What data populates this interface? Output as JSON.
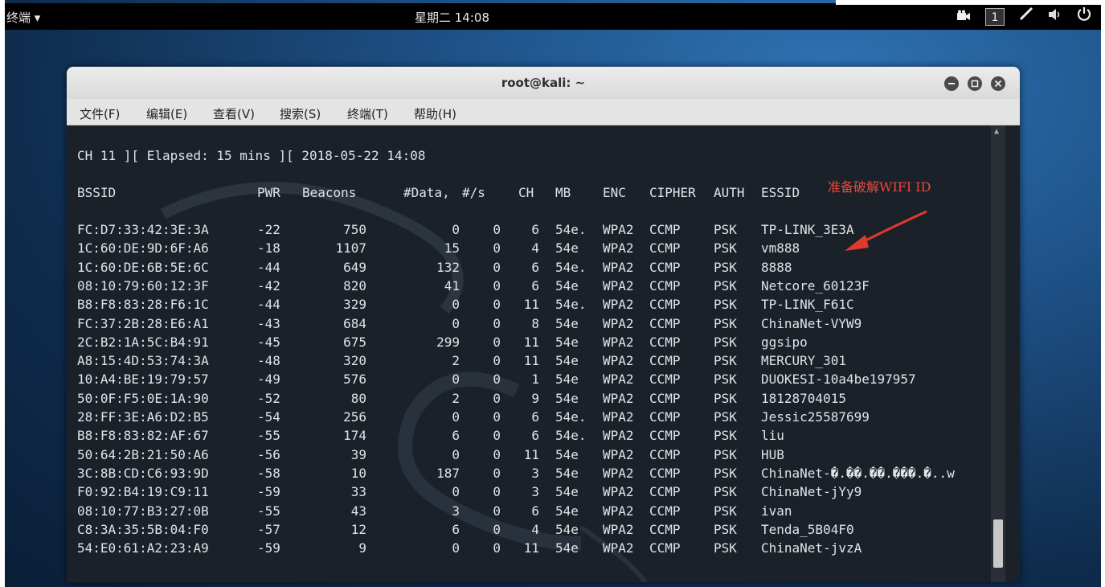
{
  "topbar": {
    "app_menu": "终端 ▾",
    "clock": "星期二 14:08",
    "workspace": "1",
    "icons": [
      "video-icon",
      "pen-icon",
      "volume-icon",
      "power-icon"
    ]
  },
  "window": {
    "title": "root@kali: ~",
    "menu": [
      "文件(F)",
      "编辑(E)",
      "查看(V)",
      "搜索(S)",
      "终端(T)",
      "帮助(H)"
    ]
  },
  "terminal": {
    "status_line": "CH 11 ][ Elapsed: 15 mins ][ 2018-05-22 14:08",
    "headers": [
      "BSSID",
      "PWR",
      "Beacons",
      "#Data,",
      "#/s",
      "CH",
      "MB",
      "ENC",
      "CIPHER",
      "AUTH",
      "ESSID"
    ],
    "annotation": "准备破解WIFI ID",
    "rows": [
      [
        "FC:D7:33:42:3E:3A",
        "-22",
        "750",
        "0",
        "0",
        "6",
        "54e.",
        "WPA2",
        "CCMP",
        "PSK",
        "TP-LINK_3E3A"
      ],
      [
        "1C:60:DE:9D:6F:A6",
        "-18",
        "1107",
        "15",
        "0",
        "4",
        "54e",
        "WPA2",
        "CCMP",
        "PSK",
        "vm888"
      ],
      [
        "1C:60:DE:6B:5E:6C",
        "-44",
        "649",
        "132",
        "0",
        "6",
        "54e.",
        "WPA2",
        "CCMP",
        "PSK",
        "8888"
      ],
      [
        "08:10:79:60:12:3F",
        "-42",
        "820",
        "41",
        "0",
        "6",
        "54e",
        "WPA2",
        "CCMP",
        "PSK",
        "Netcore_60123F"
      ],
      [
        "B8:F8:83:28:F6:1C",
        "-44",
        "329",
        "0",
        "0",
        "11",
        "54e.",
        "WPA2",
        "CCMP",
        "PSK",
        "TP-LINK_F61C"
      ],
      [
        "FC:37:2B:28:E6:A1",
        "-43",
        "684",
        "0",
        "0",
        "8",
        "54e",
        "WPA2",
        "CCMP",
        "PSK",
        "ChinaNet-VYW9"
      ],
      [
        "2C:B2:1A:5C:B4:91",
        "-45",
        "675",
        "299",
        "0",
        "11",
        "54e",
        "WPA2",
        "CCMP",
        "PSK",
        "ggsipo"
      ],
      [
        "A8:15:4D:53:74:3A",
        "-48",
        "320",
        "2",
        "0",
        "11",
        "54e",
        "WPA2",
        "CCMP",
        "PSK",
        "MERCURY_301"
      ],
      [
        "10:A4:BE:19:79:57",
        "-49",
        "576",
        "0",
        "0",
        "1",
        "54e",
        "WPA2",
        "CCMP",
        "PSK",
        "DUOKESI-10a4be197957"
      ],
      [
        "50:0F:F5:0E:1A:90",
        "-52",
        "80",
        "2",
        "0",
        "9",
        "54e",
        "WPA2",
        "CCMP",
        "PSK",
        "18128704015"
      ],
      [
        "28:FF:3E:A6:D2:B5",
        "-54",
        "256",
        "0",
        "0",
        "6",
        "54e.",
        "WPA2",
        "CCMP",
        "PSK",
        "Jessic25587699"
      ],
      [
        "B8:F8:83:82:AF:67",
        "-55",
        "174",
        "6",
        "0",
        "6",
        "54e.",
        "WPA2",
        "CCMP",
        "PSK",
        "liu"
      ],
      [
        "50:64:2B:21:50:A6",
        "-56",
        "39",
        "0",
        "0",
        "11",
        "54e",
        "WPA2",
        "CCMP",
        "PSK",
        "HUB"
      ],
      [
        "3C:8B:CD:C6:93:9D",
        "-58",
        "10",
        "187",
        "0",
        "3",
        "54e",
        "WPA2",
        "CCMP",
        "PSK",
        "ChinaNet-�.��.��.���.�..w"
      ],
      [
        "F0:92:B4:19:C9:11",
        "-59",
        "33",
        "0",
        "0",
        "3",
        "54e",
        "WPA2",
        "CCMP",
        "PSK",
        "ChinaNet-jYy9"
      ],
      [
        "08:10:77:B3:27:0B",
        "-55",
        "43",
        "3",
        "0",
        "6",
        "54e",
        "WPA2",
        "CCMP",
        "PSK",
        "ivan"
      ],
      [
        "C8:3A:35:5B:04:F0",
        "-57",
        "12",
        "6",
        "0",
        "4",
        "54e",
        "WPA2",
        "CCMP",
        "PSK",
        "Tenda_5B04F0"
      ],
      [
        "54:E0:61:A2:23:A9",
        "-59",
        "9",
        "0",
        "0",
        "11",
        "54e",
        "WPA2",
        "CCMP",
        "PSK",
        "ChinaNet-jvzA"
      ]
    ]
  },
  "colors": {
    "terminal_bg": "#1b2129",
    "terminal_fg": "#dfe4e8",
    "annotation": "#e8473b",
    "topbar_bg": "#000000"
  }
}
